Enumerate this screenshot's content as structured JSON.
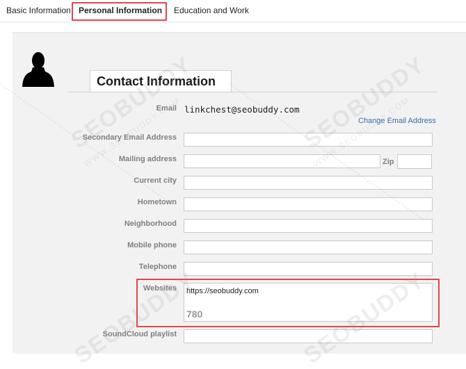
{
  "tabs": [
    {
      "label": "Basic Information"
    },
    {
      "label": "Personal Information"
    },
    {
      "label": "Education and Work"
    }
  ],
  "section": {
    "title": "Contact Information"
  },
  "email": {
    "label": "Email",
    "value": "linkchest@seobuddy.com",
    "change_link": "Change Email Address"
  },
  "fields": {
    "secondary_email": {
      "label": "Secondary Email Address",
      "value": ""
    },
    "mailing_address": {
      "label": "Mailing address",
      "value": ""
    },
    "zip": {
      "label": "Zip",
      "value": ""
    },
    "current_city": {
      "label": "Current city",
      "value": ""
    },
    "hometown": {
      "label": "Hometown",
      "value": ""
    },
    "neighborhood": {
      "label": "Neighborhood",
      "value": ""
    },
    "mobile_phone": {
      "label": "Mobile phone",
      "value": ""
    },
    "telephone": {
      "label": "Telephone",
      "value": ""
    },
    "websites": {
      "label": "Websites",
      "value": "https://seobuddy.com",
      "char_count": "780"
    },
    "soundcloud": {
      "label": "SoundCloud playlist",
      "value": ""
    }
  },
  "watermark": {
    "text": "SEOBUDDY",
    "subtext": "WWW.SEOBUDDY.COM"
  },
  "colors": {
    "highlight": "#e0464b",
    "link": "#3b6ea5",
    "panel": "#f2f2f2"
  }
}
